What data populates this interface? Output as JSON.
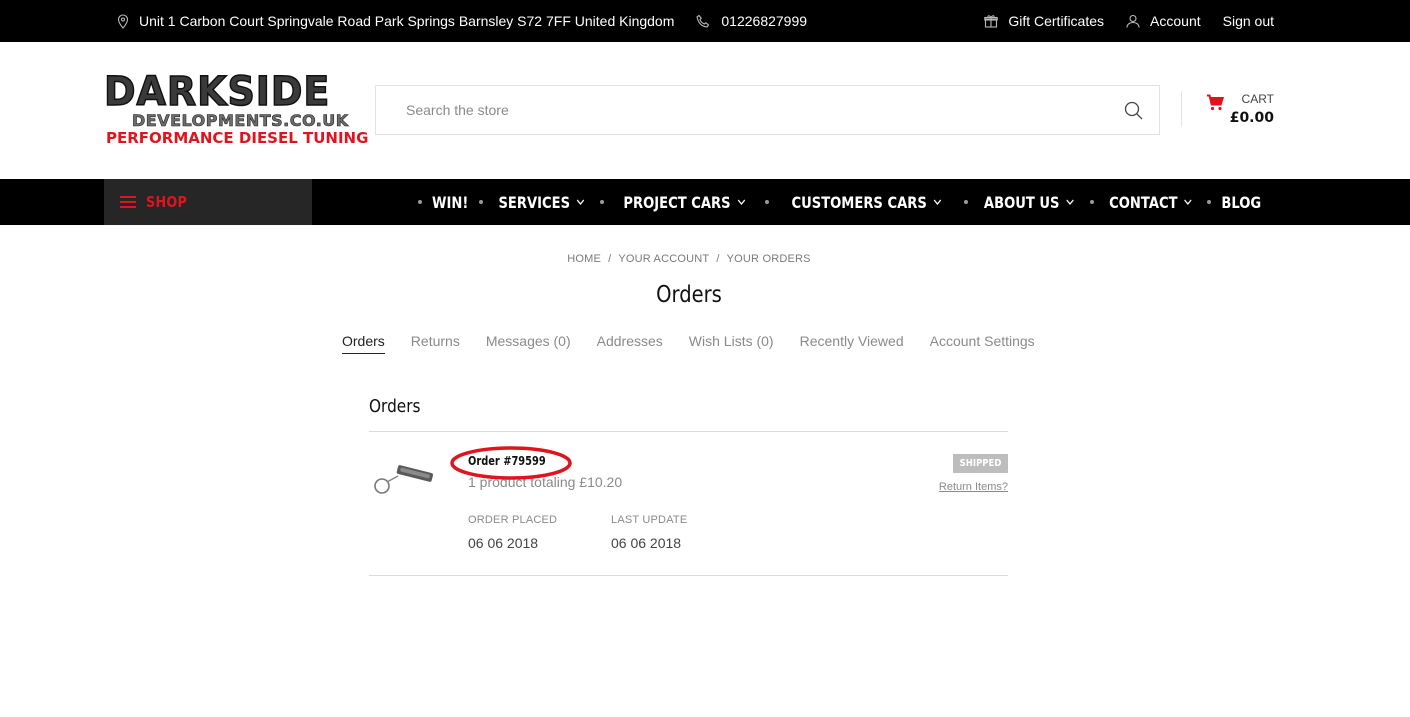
{
  "topbar": {
    "address": "Unit 1 Carbon Court Springvale Road Park Springs Barnsley S72 7FF United Kingdom",
    "phone": "01226827999",
    "gift_certificates": "Gift Certificates",
    "account": "Account",
    "sign_out": "Sign out"
  },
  "logo": {
    "line1": "DARKSIDE",
    "line2": "DEVELOPMENTS.CO.UK",
    "line3": "PERFORMANCE DIESEL TUNING"
  },
  "search": {
    "placeholder": "Search the store",
    "value": ""
  },
  "cart": {
    "label": "CART",
    "total": "£0.00"
  },
  "nav": {
    "shop_label": "SHOP",
    "items": [
      {
        "label": "WIN!",
        "dropdown": false
      },
      {
        "label": "SERVICES",
        "dropdown": true
      },
      {
        "label": "PROJECT CARS",
        "dropdown": true
      },
      {
        "label": "CUSTOMERS CARS",
        "dropdown": true
      },
      {
        "label": "ABOUT US",
        "dropdown": true
      },
      {
        "label": "CONTACT",
        "dropdown": true
      },
      {
        "label": "BLOG",
        "dropdown": false
      }
    ]
  },
  "breadcrumb": [
    "HOME",
    "YOUR ACCOUNT",
    "YOUR ORDERS"
  ],
  "page_title": "Orders",
  "account_tabs": [
    "Orders",
    "Returns",
    "Messages (0)",
    "Addresses",
    "Wish Lists (0)",
    "Recently Viewed",
    "Account Settings"
  ],
  "orders_section": {
    "title": "Orders",
    "order": {
      "number": "Order #79599",
      "summary": "1 product totaling £10.20",
      "status": "SHIPPED",
      "return_link": "Return Items?",
      "placed_label": "ORDER PLACED",
      "placed_value": "06 06 2018",
      "updated_label": "LAST UPDATE",
      "updated_value": "06 06 2018"
    }
  },
  "colors": {
    "brand_red": "#e0141e",
    "nav_bg": "#000000",
    "highlight_circle": "#e0141e"
  }
}
